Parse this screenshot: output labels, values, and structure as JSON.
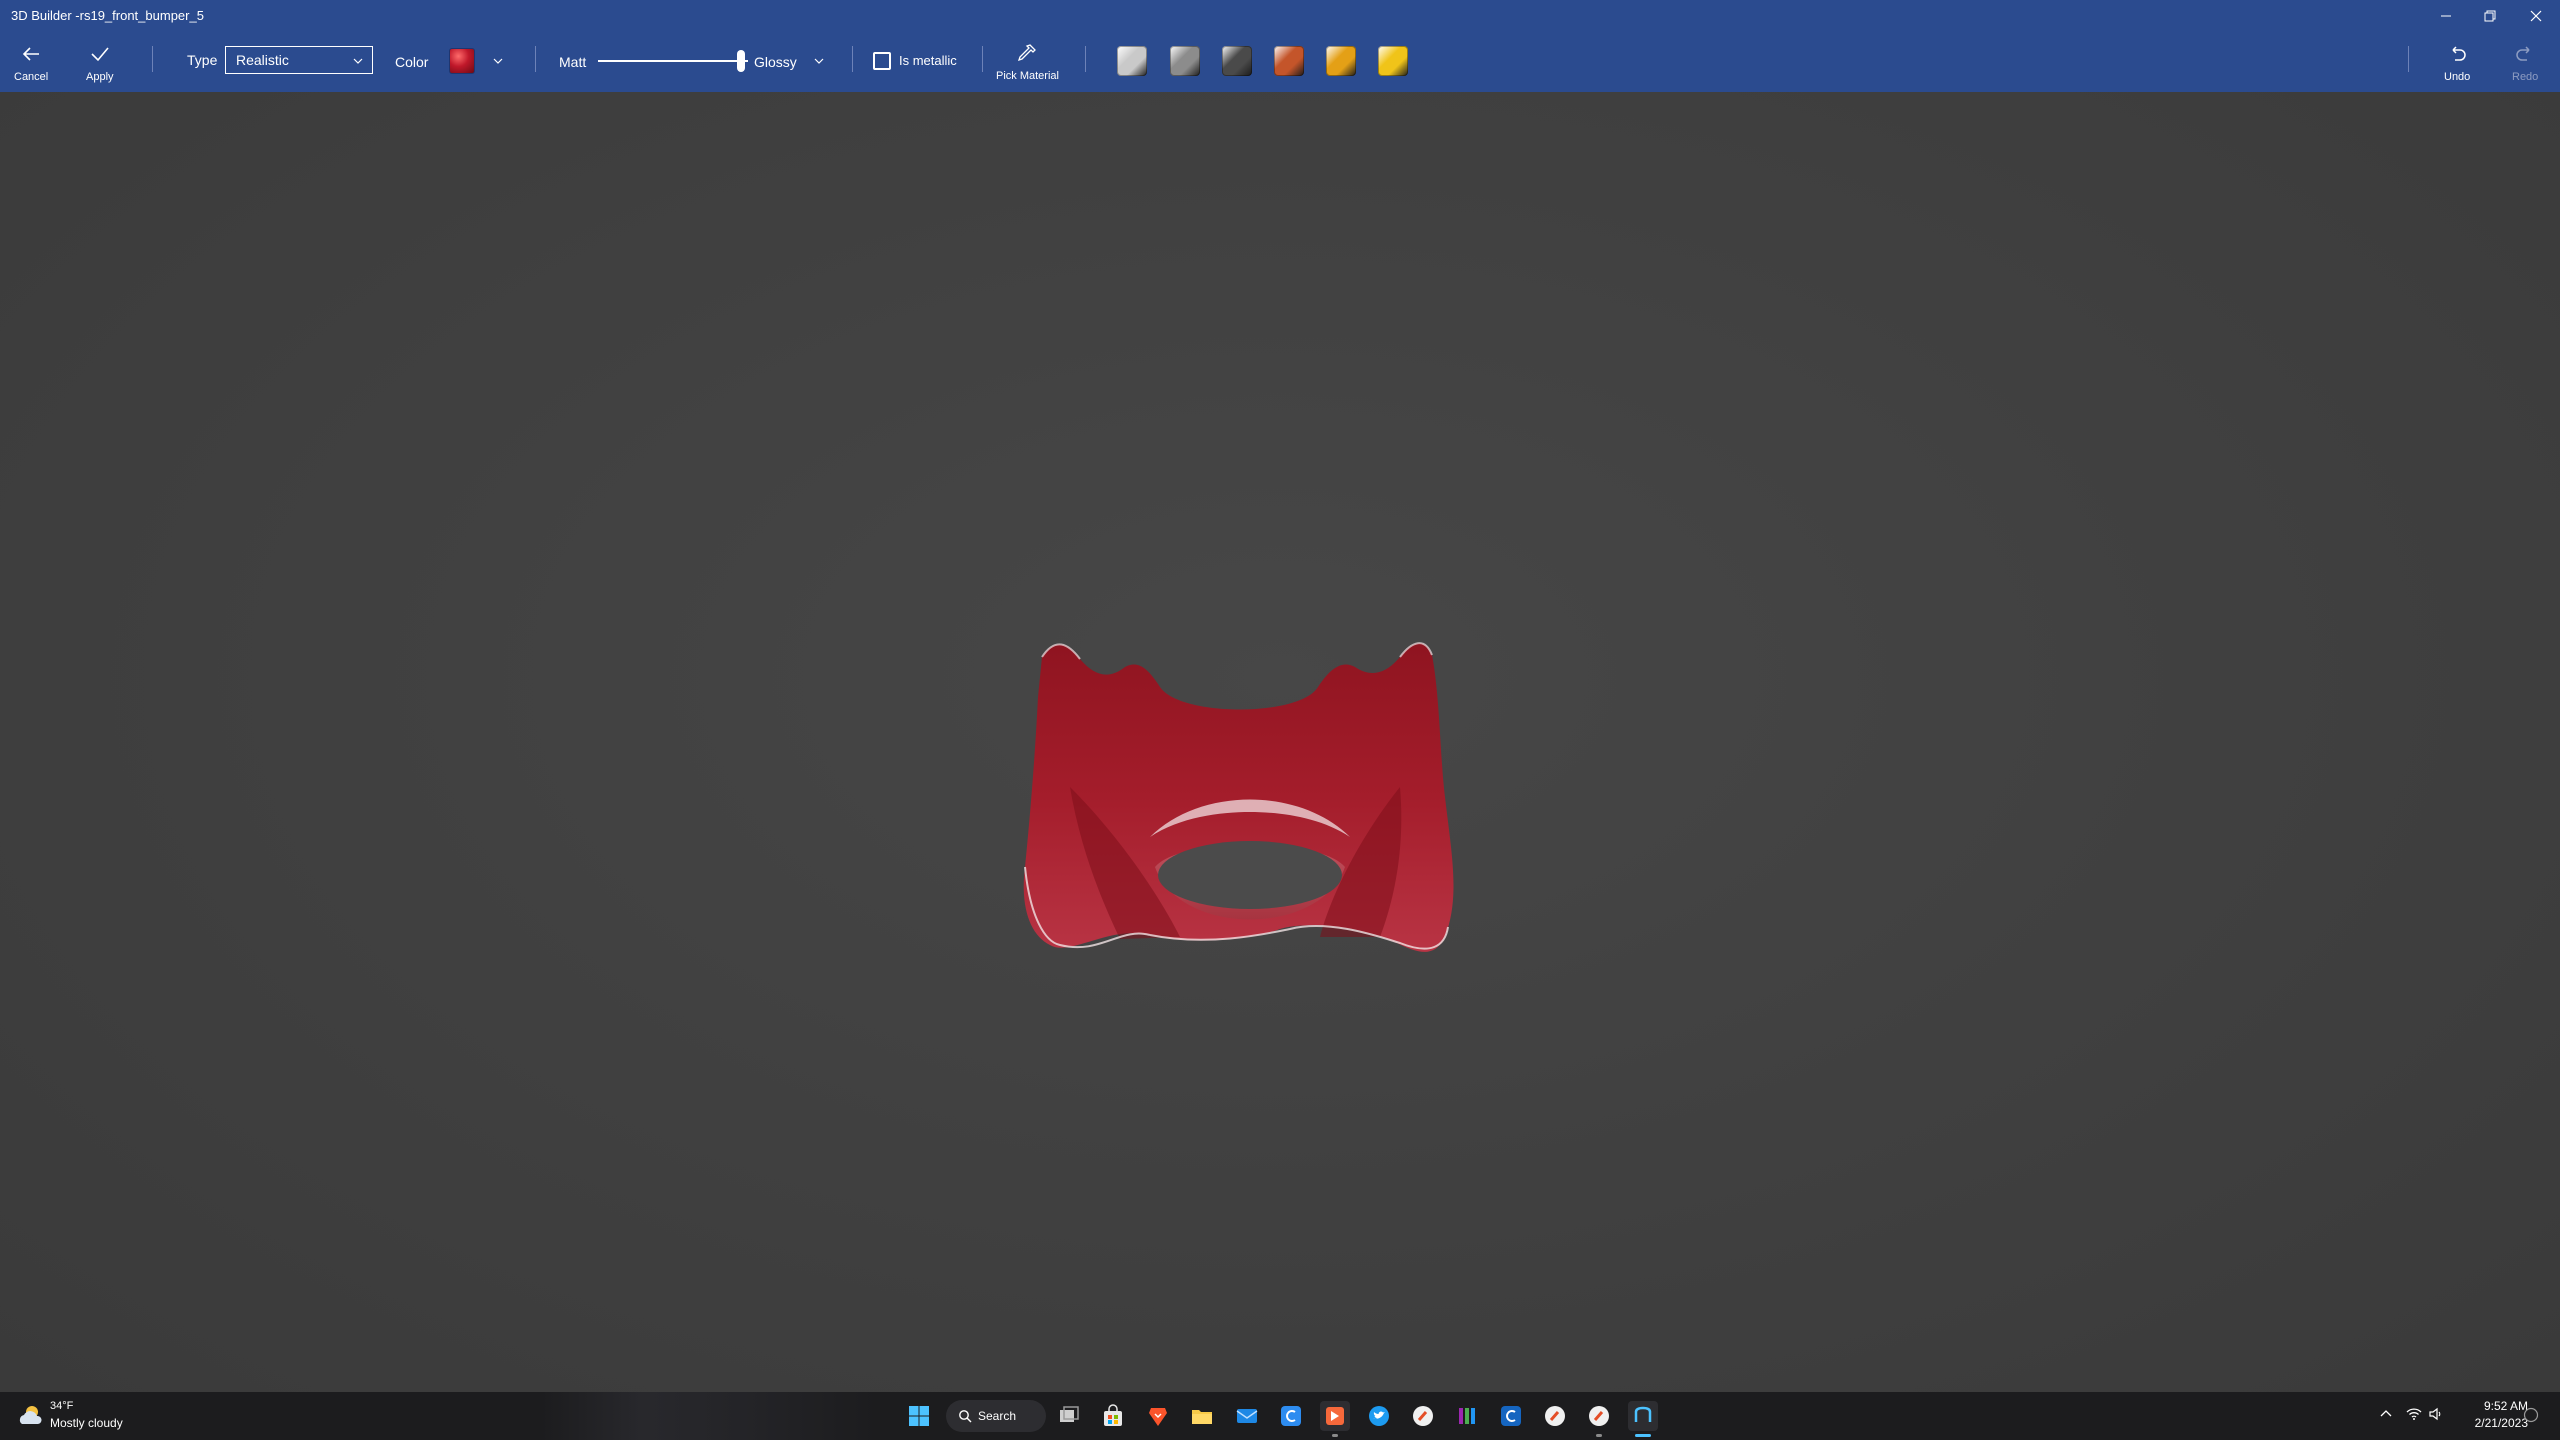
{
  "window": {
    "title": "3D Builder -rs19_front_bumper_5"
  },
  "toolbar": {
    "cancel_label": "Cancel",
    "apply_label": "Apply",
    "type_label": "Type",
    "type_value": "Realistic",
    "color_label": "Color",
    "matt_label": "Matt",
    "glossy_label": "Glossy",
    "glossiness": 0.95,
    "metallic_label": "Is metallic",
    "metallic_checked": false,
    "pick_material_label": "Pick Material",
    "undo_label": "Undo",
    "redo_label": "Redo",
    "current_color": "#b3192a",
    "materials": [
      {
        "name": "material-silver",
        "color": "#c9c9c9"
      },
      {
        "name": "material-grey",
        "color": "#8c8c8c"
      },
      {
        "name": "material-dark-grey",
        "color": "#4a4a4a"
      },
      {
        "name": "material-copper",
        "color": "#c4552a"
      },
      {
        "name": "material-gold",
        "color": "#e4a016"
      },
      {
        "name": "material-yellow-gold",
        "color": "#f0c419"
      }
    ]
  },
  "model": {
    "color": "#9b1a26"
  },
  "taskbar": {
    "weather_temp": "34°F",
    "weather_condition": "Mostly cloudy",
    "search_label": "Search",
    "time": "9:52 AM",
    "date": "2/21/2023"
  },
  "colors": {
    "accent": "#2b4b8f",
    "viewport": "#414141",
    "taskbar": "#1c1c1e"
  }
}
